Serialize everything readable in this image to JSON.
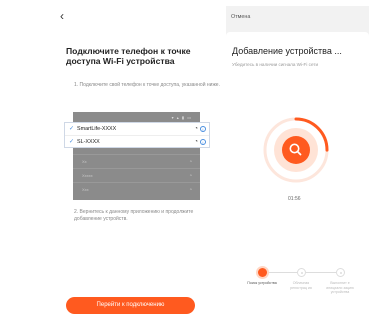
{
  "left": {
    "back_icon": "chevron-left-icon",
    "back_glyph": "‹",
    "title": "Подключите телефон к точке доступа Wi-Fi устройства",
    "step1": "1. Подключите свой телефон к точке доступа, указанной ниже.",
    "panel": {
      "status": "▾ ▴ ▮ ▭",
      "wifi_label": "Wi-Fi",
      "rows": [
        "Xx",
        "Xxxxx",
        "Xxx"
      ]
    },
    "networks": [
      {
        "name": "SmartLife-XXXX"
      },
      {
        "name": "SL-XXXX"
      }
    ],
    "step2": "2. Вернитесь к данному приложению и продолжите добавление устройств.",
    "connect_button": "Перейти к подключению",
    "accent": "#ff5a1f"
  },
  "right": {
    "cancel": "Отмена",
    "title": "Добавление устройства ...",
    "subtitle": "Убедитесь в наличии сигнала Wi-Fi сети",
    "search_icon": "search-icon",
    "progress_fraction": 0.25,
    "timer": "01:56",
    "steps": [
      {
        "label": "Поиск устройства",
        "state": "active"
      },
      {
        "label": "Облачная регистрац ия",
        "state": "idle"
      },
      {
        "label": "Выполнит е инициали зацию устройства",
        "state": "idle"
      }
    ]
  }
}
